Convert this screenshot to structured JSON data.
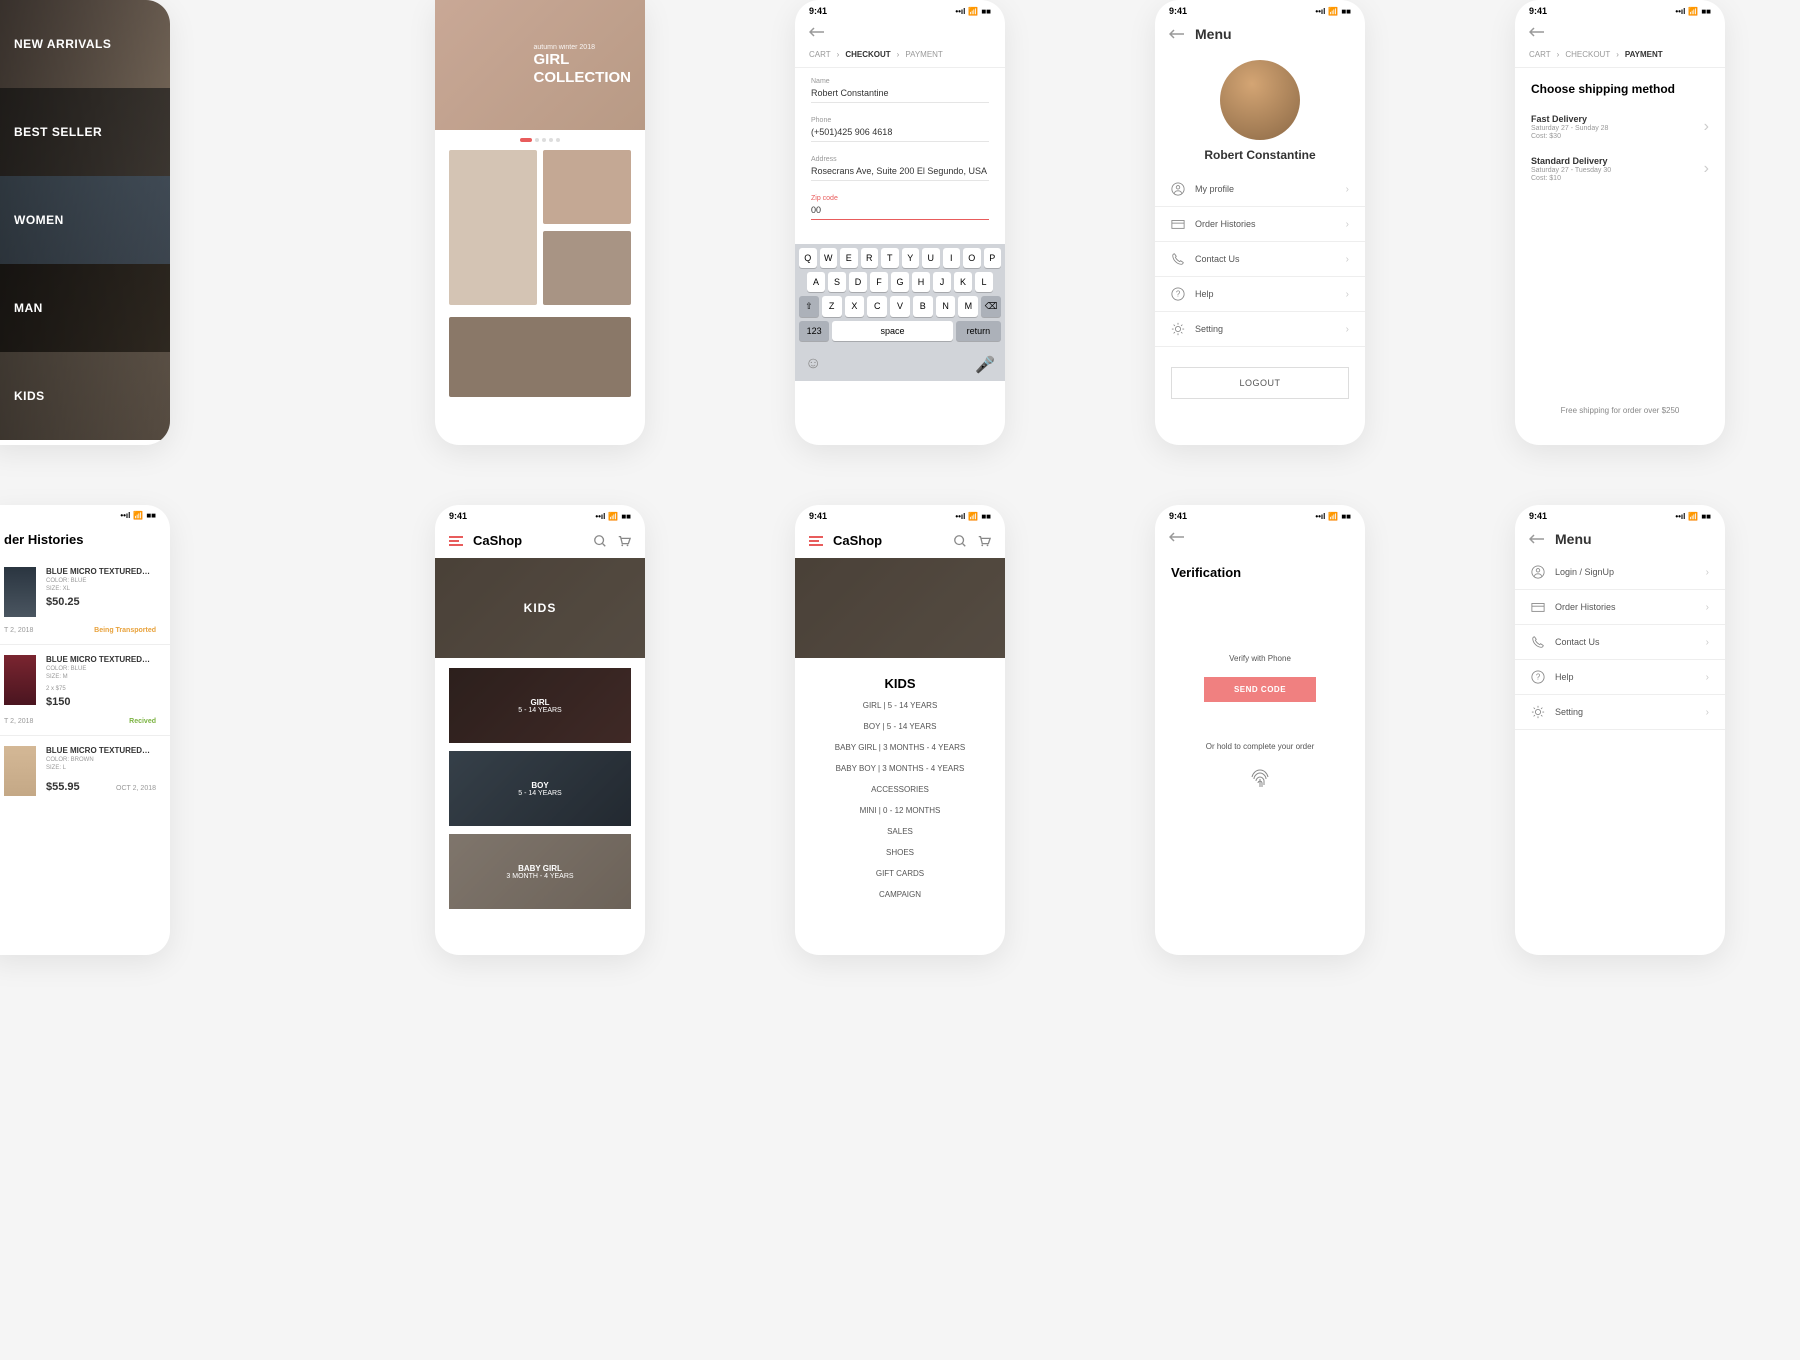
{
  "status": {
    "time": "9:41"
  },
  "screen1": {
    "cats": [
      "NEW ARRIVALS",
      "BEST SELLER",
      "WOMEN",
      "MAN",
      "KIDS"
    ]
  },
  "screen2": {
    "season": "autumn winter 2018",
    "title1": "GIRL",
    "title2": "COLLECTION"
  },
  "screen3": {
    "crumbs": {
      "cart": "CART",
      "checkout": "CHECKOUT",
      "payment": "PAYMENT"
    },
    "fields": {
      "name_label": "Name",
      "name_val": "Robert Constantine",
      "phone_label": "Phone",
      "phone_val": "(+501)425 906 4618",
      "address_label": "Address",
      "address_val": "Rosecrans Ave, Suite 200 El Segundo, USA",
      "zip_label": "Zip code",
      "zip_val": "00"
    },
    "keys": {
      "r1": [
        "Q",
        "W",
        "E",
        "R",
        "T",
        "Y",
        "U",
        "I",
        "O",
        "P"
      ],
      "r2": [
        "A",
        "S",
        "D",
        "F",
        "G",
        "H",
        "J",
        "K",
        "L"
      ],
      "r3": [
        "Z",
        "X",
        "C",
        "V",
        "B",
        "N",
        "M"
      ],
      "num": "123",
      "space": "space",
      "ret": "return"
    }
  },
  "screen4": {
    "title": "Menu",
    "name": "Robert Constantine",
    "items": [
      "My profile",
      "Order Histories",
      "Contact Us",
      "Help",
      "Setting"
    ],
    "logout": "LOGOUT"
  },
  "screen5": {
    "title": "Choose shipping method",
    "opt1": {
      "name": "Fast Delivery",
      "sub": "Saturday 27 - Sunday 28",
      "cost": "Cost: $30"
    },
    "opt2": {
      "name": "Standard Delivery",
      "sub": "Saturday 27 - Tuesday 30",
      "cost": "Cost: $10"
    },
    "note": "Free shipping for order over $250"
  },
  "screen6": {
    "title": "der Histories",
    "o1": {
      "name": "BLUE MICRO TEXTURED…",
      "color": "COLOR: BLUE",
      "size": "SIZE: XL",
      "price": "$50.25",
      "date": "T 2, 2018",
      "status": "Being Transported"
    },
    "o2": {
      "name": "BLUE MICRO TEXTURED…",
      "color": "COLOR: BLUE",
      "size": "SIZE: M",
      "qty": "2 x $75",
      "price": "$150",
      "date": "T 2, 2018",
      "status": "Recived"
    },
    "o3": {
      "name": "BLUE MICRO TEXTURED…",
      "color": "COLOR: BROWN",
      "size": "SIZE: L",
      "price": "$55.95",
      "date": "OCT 2, 2018"
    }
  },
  "screen7": {
    "brand": "CaShop",
    "hero": "KIDS",
    "subs": [
      {
        "name": "GIRL",
        "age": "5 - 14 YEARS"
      },
      {
        "name": "BOY",
        "age": "5 - 14 YEARS"
      },
      {
        "name": "BABY GIRL",
        "age": "3 MONTH - 4 YEARS"
      }
    ]
  },
  "screen8": {
    "brand": "CaShop",
    "title": "KIDS",
    "list": [
      "GIRL | 5 - 14 YEARS",
      "BOY | 5 - 14 YEARS",
      "BABY GIRL | 3 MONTHS - 4 YEARS",
      "BABY BOY | 3 MONTHS - 4 YEARS",
      "ACCESSORIES",
      "MINI | 0 - 12 MONTHS",
      "SALES",
      "SHOES",
      "GIFT CARDS",
      "CAMPAIGN"
    ]
  },
  "screen9": {
    "title": "Verification",
    "sub": "Verify with Phone",
    "btn": "SEND CODE",
    "or": "Or hold to complete your order"
  },
  "screen10": {
    "title": "Menu",
    "items": [
      "Login / SignUp",
      "Order Histories",
      "Contact Us",
      "Help",
      "Setting"
    ]
  }
}
